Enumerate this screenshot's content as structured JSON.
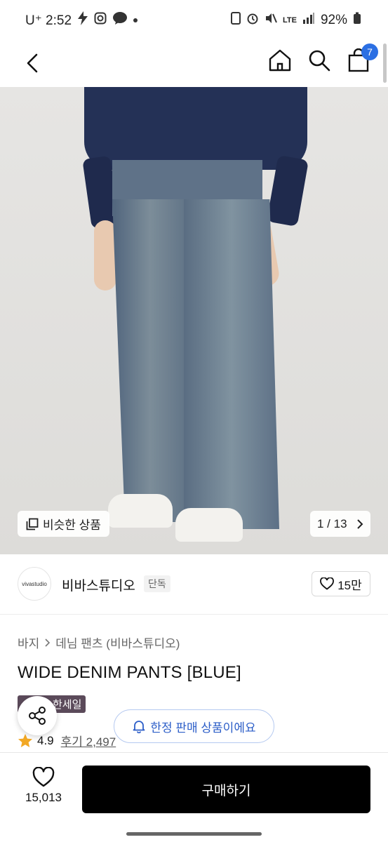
{
  "status_bar": {
    "carrier_time": "U⁺ 2:52",
    "network": "LTE",
    "battery": "92%"
  },
  "nav": {
    "cart_count": "7"
  },
  "gallery": {
    "similar_label": "비슷한 상품",
    "counter": "1 / 13"
  },
  "brand": {
    "logo_text": "vivastudio",
    "name": "비바스튜디오",
    "tag": "단독",
    "likes": "15만"
  },
  "breadcrumb": {
    "category": "바지",
    "subcategory": "데님 팬츠 (비바스튜디오)"
  },
  "product": {
    "title": "WIDE DENIM PANTS [BLUE]",
    "sale_badge": "한세일",
    "rating": "4.9",
    "reviews": "후기 2,497"
  },
  "banner": {
    "limited_label": "한정 판매 상품이에요"
  },
  "bottom": {
    "wish_count": "15,013",
    "buy_label": "구매하기"
  }
}
